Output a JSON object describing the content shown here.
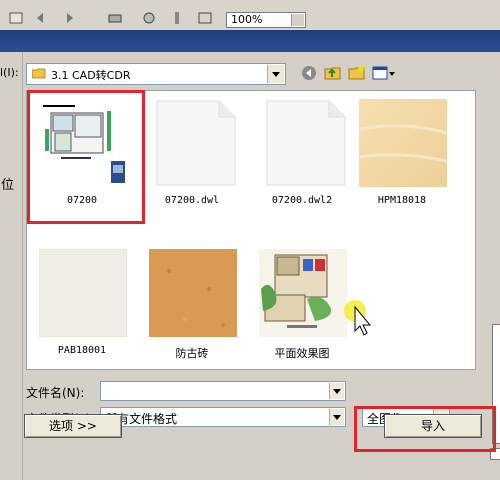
{
  "toolbar": {
    "zoom": "100%"
  },
  "dialog": {
    "left_label": "位",
    "look_in": {
      "label": "l(I):",
      "value": "3.1 CAD转CDR"
    },
    "files": [
      {
        "name": "07200",
        "type": "cad-thumb"
      },
      {
        "name": "07200.dwl",
        "type": "doc"
      },
      {
        "name": "07200.dwl2",
        "type": "doc"
      },
      {
        "name": "HPM18018",
        "type": "tile-beige"
      },
      {
        "name": "PAB18001",
        "type": "tile-cream"
      },
      {
        "name": "防古砖",
        "type": "tile-terracotta"
      },
      {
        "name": "平面效果图",
        "type": "floorplan"
      }
    ],
    "filename": {
      "label": "文件名(N):",
      "value": ""
    },
    "filetype": {
      "label": "文件类型(T):",
      "value": "所有文件格式"
    },
    "image_scope": {
      "value": "全图像"
    },
    "options_button": "选项 >>",
    "import_button": "导入"
  },
  "colors": {
    "highlight": "#e0262a",
    "title_band": "#2a4d92"
  }
}
